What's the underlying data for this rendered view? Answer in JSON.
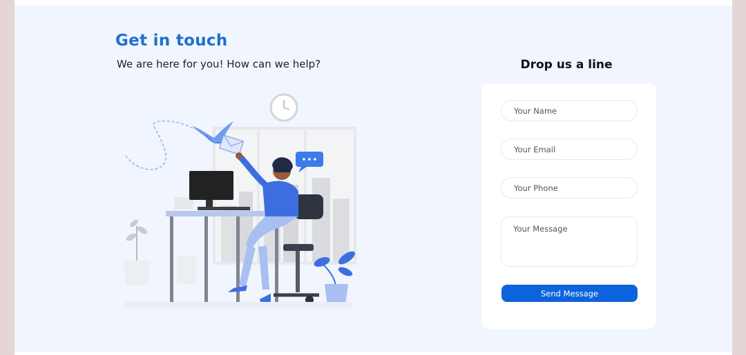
{
  "contact": {
    "heading": "Get in touch",
    "subheading": "We are here for you! How can we help?"
  },
  "form": {
    "title": "Drop us a line",
    "name_placeholder": "Your Name",
    "email_placeholder": "Your Email",
    "phone_placeholder": "Your Phone",
    "message_placeholder": "Your Message",
    "submit_label": "Send Message"
  },
  "colors": {
    "accent": "#1e6fcf",
    "button": "#0d63dc",
    "panel_background": "#f0f5fe"
  },
  "illustration": {
    "subject": "customer-support-agent-illustration",
    "icons": [
      "clock-icon",
      "bird-icon",
      "envelope-icon",
      "chat-bubble-icon",
      "monitor-icon",
      "plant-icon"
    ]
  }
}
